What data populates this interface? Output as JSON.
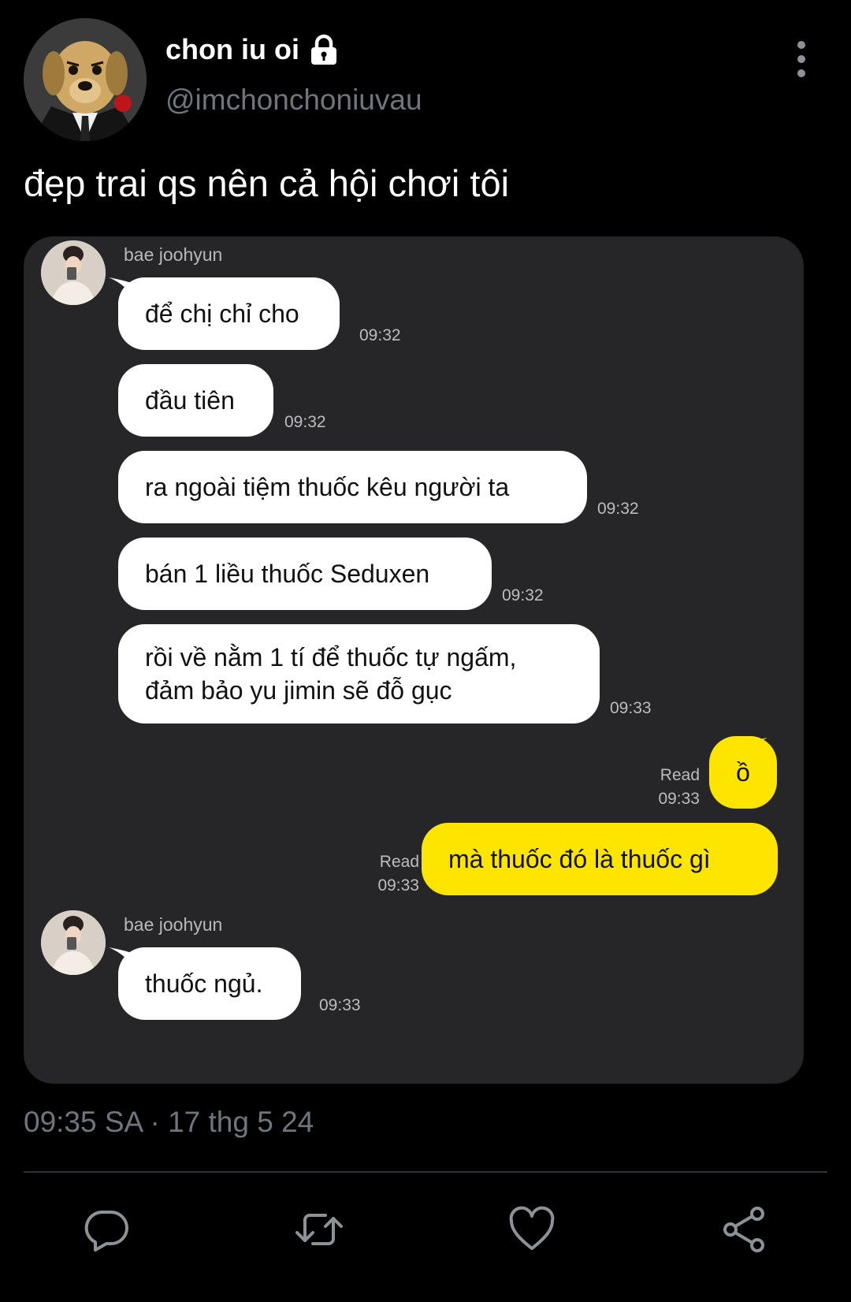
{
  "post": {
    "display_name": "chon iu oi",
    "handle": "@imchonchoniuvau",
    "text": "đẹp trai qs nên cả hội chơi tôi",
    "timestamp": "09:35 SA · 17 thg 5 24"
  },
  "chat": {
    "sender": "bae joohyun",
    "messages": [
      {
        "text": "để chị chỉ cho",
        "time": "09:32"
      },
      {
        "text": "đầu tiên",
        "time": "09:32"
      },
      {
        "text": "ra ngoài tiệm thuốc kêu người ta",
        "time": "09:32"
      },
      {
        "text": "bán 1 liều thuốc Seduxen",
        "time": "09:32"
      },
      {
        "line1": "rồi về nằm 1 tí để thuốc tự ngấm,",
        "line2": "đảm bảo yu jimin sẽ đỗ gục",
        "time": "09:33"
      }
    ],
    "replies": [
      {
        "text": "ồ",
        "read": "Read",
        "time": "09:33"
      },
      {
        "text": "mà thuốc đó là thuốc gì",
        "read": "Read",
        "time": "09:33"
      }
    ],
    "last_sender": "bae joohyun",
    "last_message": {
      "text": "thuốc ngủ.",
      "time": "09:33"
    }
  },
  "icons": {
    "lock": "lock-icon",
    "more": "more-vertical-icon",
    "reply": "reply-icon",
    "retweet": "retweet-icon",
    "like": "heart-icon",
    "share": "share-icon"
  },
  "colors": {
    "background": "#000000",
    "card": "#262628",
    "my_bubble": "#fee500",
    "their_bubble": "#ffffff",
    "muted_text": "#6e767d",
    "icon": "#8b9399"
  }
}
